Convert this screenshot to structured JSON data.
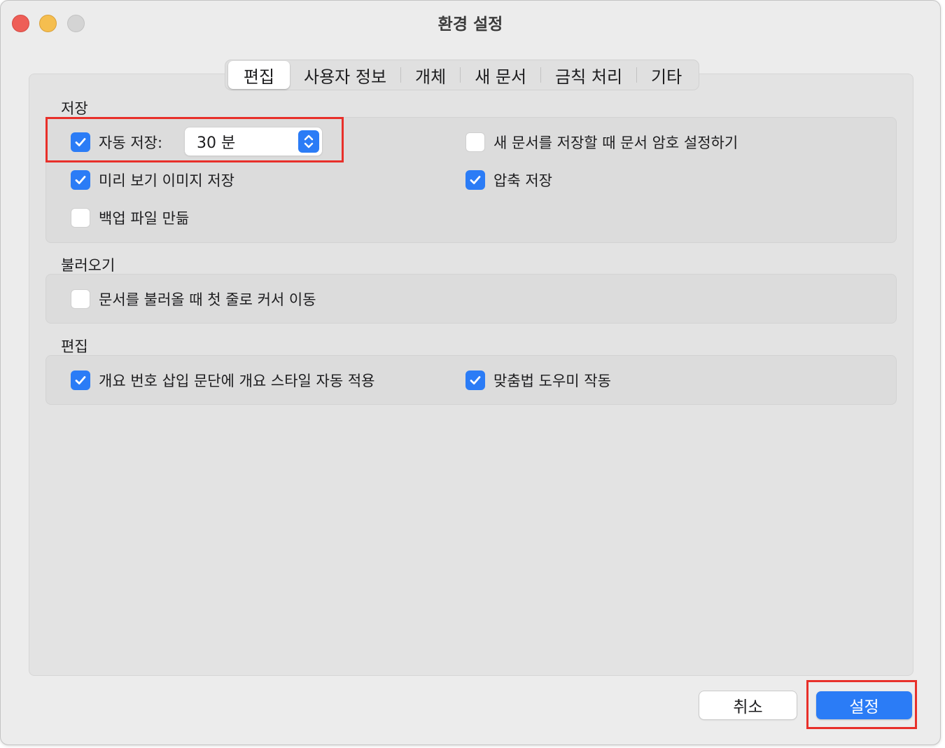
{
  "window": {
    "title": "환경 설정"
  },
  "tabs": [
    {
      "label": "편집",
      "active": true
    },
    {
      "label": "사용자 정보"
    },
    {
      "label": "개체"
    },
    {
      "label": "새 문서"
    },
    {
      "label": "금칙 처리"
    },
    {
      "label": "기타"
    }
  ],
  "sections": {
    "save": {
      "title": "저장",
      "auto_save": {
        "label": "자동 저장:",
        "checked": true,
        "interval": "30 분"
      },
      "password_on_save": {
        "label": "새 문서를 저장할 때 문서 암호 설정하기",
        "checked": false
      },
      "preview_image": {
        "label": "미리 보기 이미지 저장",
        "checked": true
      },
      "compress": {
        "label": "압축 저장",
        "checked": true
      },
      "backup": {
        "label": "백업 파일 만듦",
        "checked": false
      }
    },
    "load": {
      "title": "불러오기",
      "cursor_first_line": {
        "label": "문서를 불러올 때 첫 줄로 커서 이동",
        "checked": false
      }
    },
    "edit": {
      "title": "편집",
      "outline_style": {
        "label": "개요 번호 삽입 문단에 개요 스타일 자동 적용",
        "checked": true
      },
      "spell_helper": {
        "label": "맞춤법 도우미 작동",
        "checked": true
      }
    }
  },
  "buttons": {
    "cancel": "취소",
    "ok": "설정"
  },
  "colors": {
    "accent": "#2b7cf6",
    "highlight": "#e8302a"
  }
}
